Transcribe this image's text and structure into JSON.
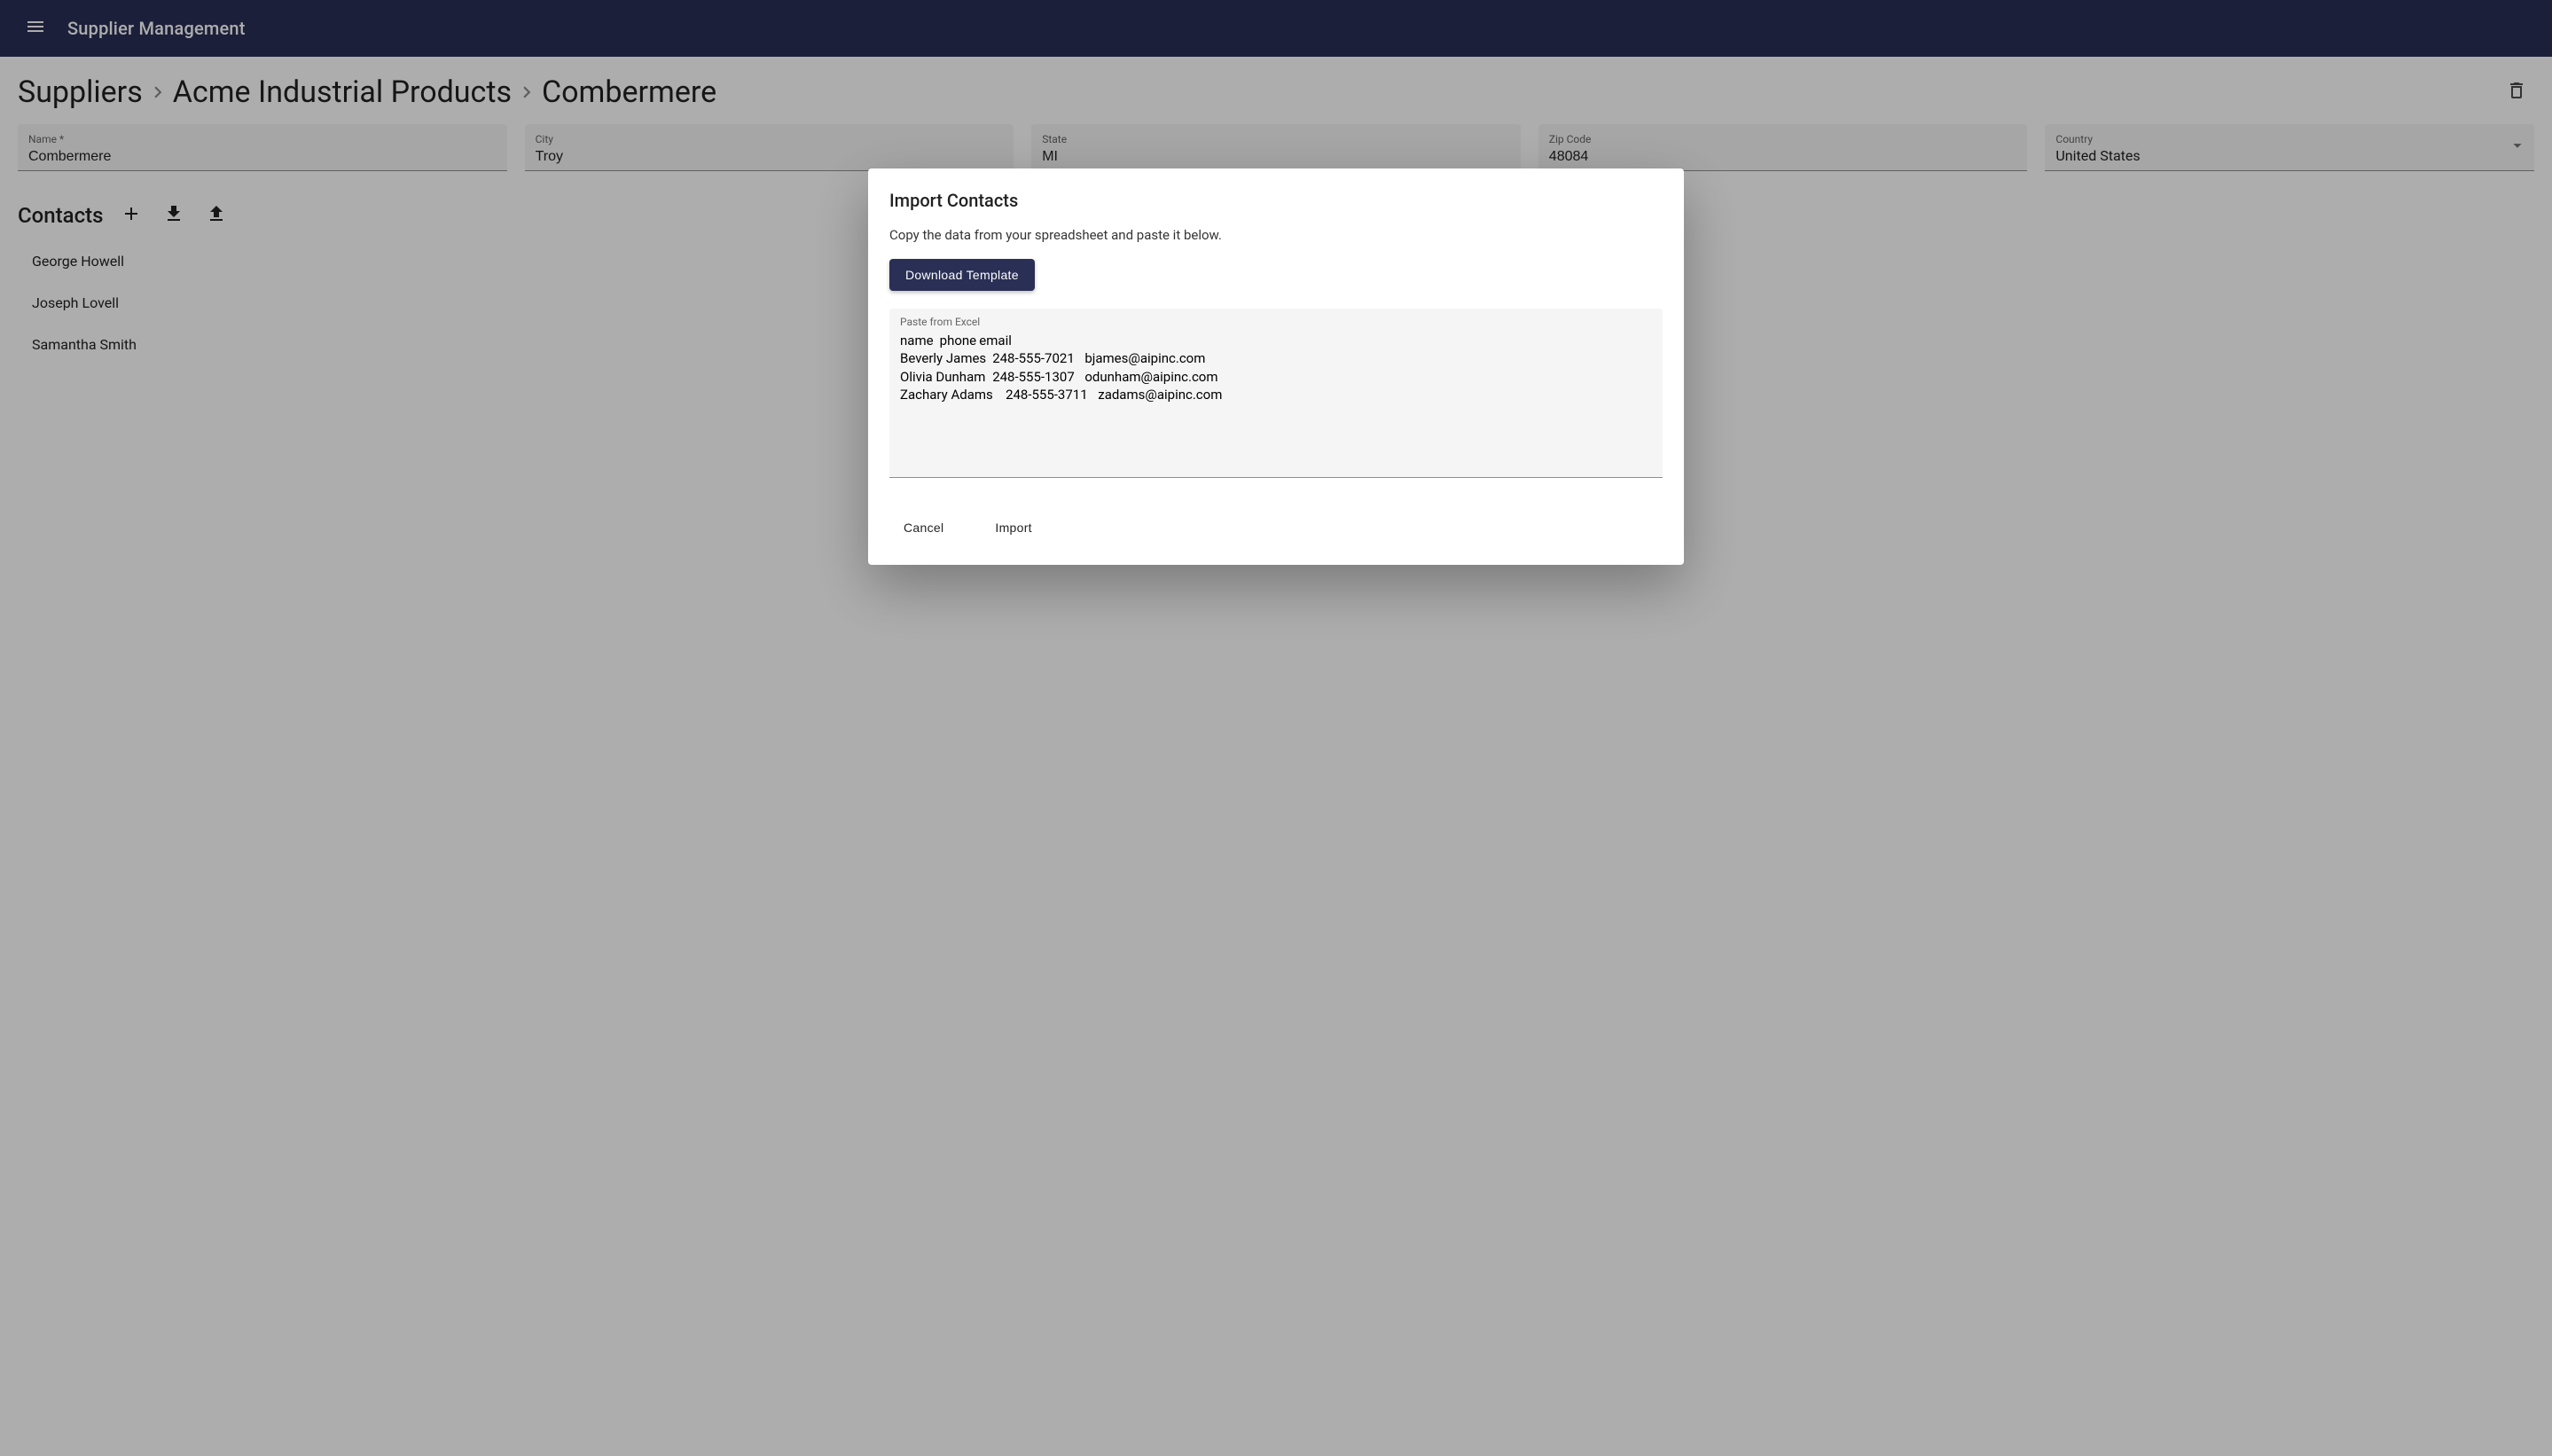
{
  "header": {
    "app_title": "Supplier Management"
  },
  "breadcrumb": {
    "level1": "Suppliers",
    "level2": "Acme Industrial Products",
    "level3": "Combermere"
  },
  "form": {
    "name": {
      "label": "Name *",
      "value": "Combermere"
    },
    "city": {
      "label": "City",
      "value": "Troy"
    },
    "state": {
      "label": "State",
      "value": "MI"
    },
    "zip": {
      "label": "Zip Code",
      "value": "48084"
    },
    "country": {
      "label": "Country",
      "value": "United States"
    }
  },
  "contacts": {
    "title": "Contacts",
    "items": [
      "George Howell",
      "Joseph Lovell",
      "Samantha Smith"
    ]
  },
  "dialog": {
    "title": "Import Contacts",
    "instruction": "Copy the data from your spreadsheet and paste it below.",
    "download_label": "Download Template",
    "paste_label": "Paste from Excel",
    "paste_value": "name\tphone\temail\nBeverly James\t248-555-7021\tbjames@aipinc.com\nOlivia Dunham\t248-555-1307\todunham@aipinc.com\nZachary Adams\t248-555-3711\tzadams@aipinc.com",
    "cancel_label": "Cancel",
    "import_label": "Import"
  },
  "icons": {
    "menu": "menu-icon",
    "delete": "trash-icon",
    "add": "plus-icon",
    "download": "download-icon",
    "upload": "upload-icon",
    "chevron": "chevron-right-icon",
    "dropdown": "dropdown-arrow-icon"
  }
}
